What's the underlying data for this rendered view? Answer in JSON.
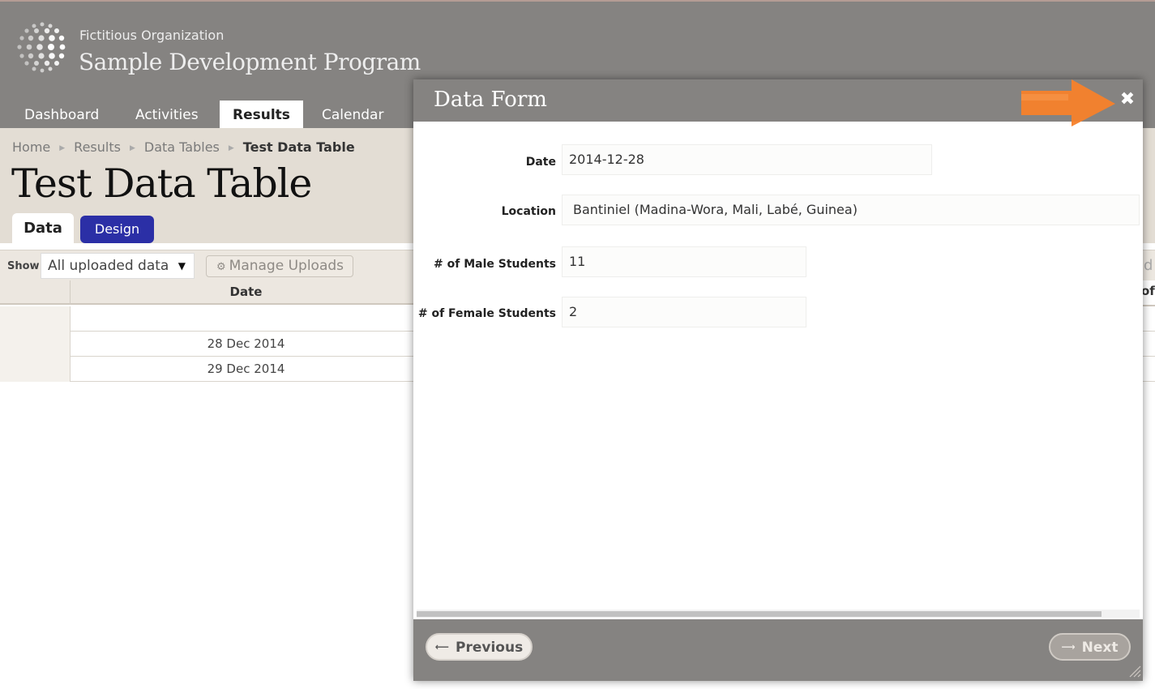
{
  "header": {
    "org_name": "Fictitious Organization",
    "program_name": "Sample Development Program"
  },
  "nav": [
    {
      "label": "Dashboard"
    },
    {
      "label": "Activities"
    },
    {
      "label": "Results",
      "active": true
    },
    {
      "label": "Calendar"
    }
  ],
  "breadcrumb": {
    "items": [
      "Home",
      "Results",
      "Data Tables"
    ],
    "current": "Test Data Table"
  },
  "page_title": "Test Data Table",
  "tabs": {
    "data": "Data",
    "design": "Design"
  },
  "toolbar": {
    "show_label": "Show",
    "show_value": "All uploaded data",
    "manage_uploads": "Manage Uploads",
    "right_fragment": "d"
  },
  "table": {
    "columns": [
      "Date"
    ],
    "right_header_fragment": "of",
    "rows": [
      {
        "date": ""
      },
      {
        "date": "28 Dec 2014"
      },
      {
        "date": "29 Dec 2014"
      }
    ]
  },
  "modal": {
    "title": "Data Form",
    "fields": {
      "date_label": "Date",
      "date_value": "2014-12-28",
      "location_label": "Location",
      "location_value": "Bantiniel (Madina-Wora, Mali, Labé, Guinea)",
      "male_label": "# of Male Students",
      "male_value": "11",
      "female_label": "# of Female Students",
      "female_value": "2"
    },
    "previous_label": "Previous",
    "next_label": "Next"
  },
  "colors": {
    "header_bg": "#858381",
    "band_bg": "#e3ddd4",
    "design_tab": "#2b2fa6",
    "annotation_arrow": "#f7812a"
  }
}
